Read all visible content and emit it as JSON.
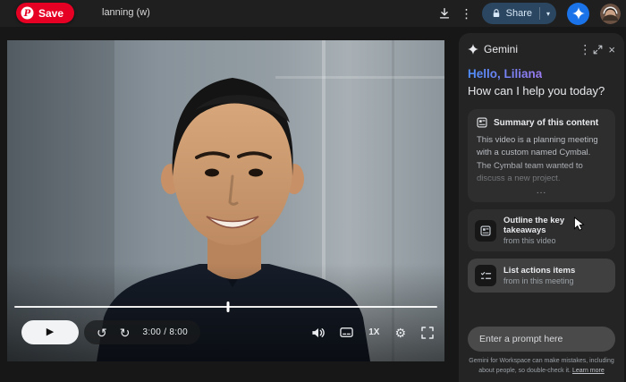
{
  "colors": {
    "pinterest-red": "#e60023",
    "gemini-blue": "#1a73e8",
    "share-bg": "#2b4660",
    "share-text": "#d7e8f8",
    "topbar-bg": "#1f1f1f",
    "page-bg": "#171717",
    "panel-bg": "#242424",
    "card-bg": "#2e2e2e",
    "chip-hover-bg": "#404040",
    "input-bg": "#4a4a4a",
    "greeting-grad-start": "#4e8cf7",
    "greeting-grad-end": "#9b7bf2"
  },
  "header": {
    "save_label": "Save",
    "title_partial": "lanning (w)",
    "share_label": "Share"
  },
  "video": {
    "time": "3:00 / 8:00",
    "speed_label": "1X",
    "progress_percent": 50.5
  },
  "gemini": {
    "app_name": "Gemini",
    "greeting_line1": "Hello, Liliana",
    "greeting_line2": "How can I help you today?",
    "summary_card": {
      "title": "Summary of this content",
      "body": "This video is a planning meeting with a custom named Cymbal. The Cymbal team wanted to discuss a new project.",
      "ellipsis": "..."
    },
    "suggestions": [
      {
        "title": "Outline the key takeaways",
        "subtitle": "from this video"
      },
      {
        "title": "List actions items",
        "subtitle": "from in this meeting"
      }
    ],
    "prompt_placeholder": "Enter a prompt here",
    "footer_text": "Gemini for Workspace can make mistakes, including about people, so double-check it.",
    "footer_link": "Learn more"
  },
  "icons": {
    "kebab": "⋮",
    "caret_down": "▾",
    "play": "▶",
    "rewind10": "↺",
    "forward10": "↻",
    "gear": "⚙",
    "close": "×"
  }
}
